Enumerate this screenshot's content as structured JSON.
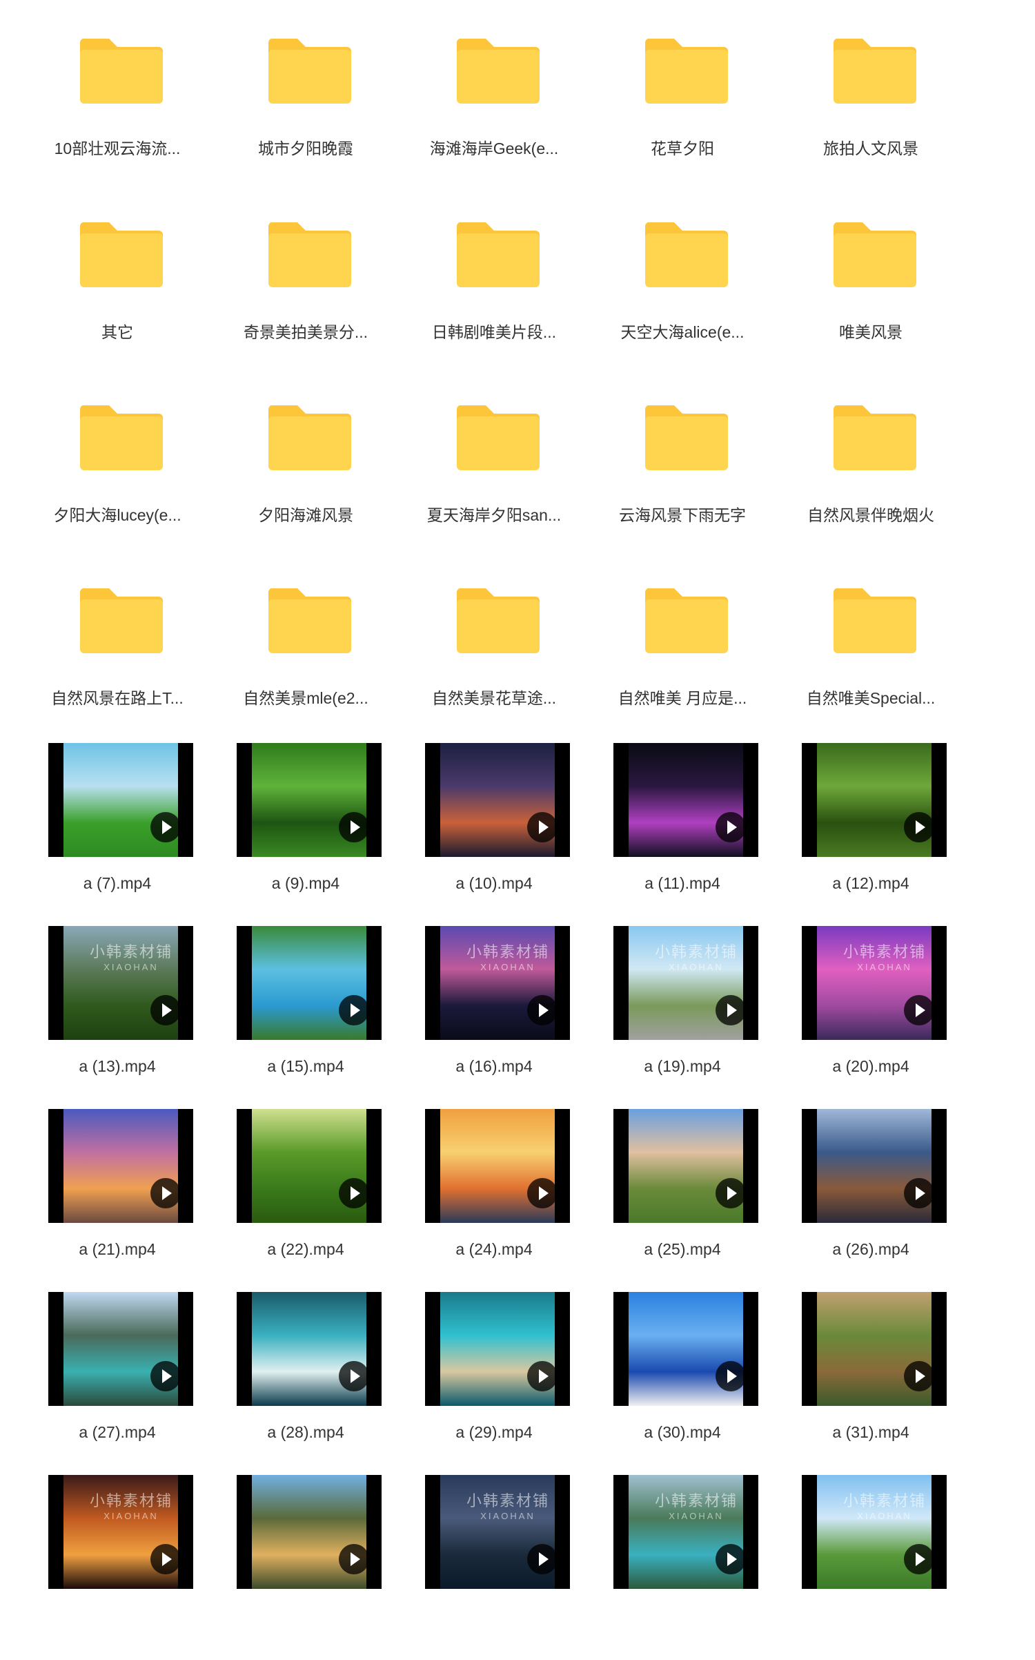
{
  "colors": {
    "folder_front": "#FFD54F",
    "folder_back": "#FDC63A",
    "label_text": "#333333"
  },
  "folders": [
    {
      "name": "10部壮观云海流..."
    },
    {
      "name": "城市夕阳晚霞"
    },
    {
      "name": "海滩海岸Geek(e..."
    },
    {
      "name": "花草夕阳"
    },
    {
      "name": "旅拍人文风景"
    },
    {
      "name": "其它"
    },
    {
      "name": "奇景美拍美景分..."
    },
    {
      "name": "日韩剧唯美片段..."
    },
    {
      "name": "天空大海alice(e..."
    },
    {
      "name": "唯美风景"
    },
    {
      "name": "夕阳大海lucey(e..."
    },
    {
      "name": "夕阳海滩风景"
    },
    {
      "name": "夏天海岸夕阳san..."
    },
    {
      "name": "云海风景下雨无字"
    },
    {
      "name": "自然风景伴晚烟火"
    },
    {
      "name": "自然风景在路上T..."
    },
    {
      "name": "自然美景mle(e2..."
    },
    {
      "name": "自然美景花草途..."
    },
    {
      "name": "自然唯美 月应是..."
    },
    {
      "name": "自然唯美Special..."
    }
  ],
  "videos": [
    {
      "name": "a (7).mp4",
      "thumb_colors": [
        "#6fc3e6",
        "#b8e0f0",
        "#3aa02a",
        "#2e8a22"
      ],
      "subject": "grassland"
    },
    {
      "name": "a (9).mp4",
      "thumb_colors": [
        "#2f7a1c",
        "#5fb33a",
        "#1d5512",
        "#3a8a22"
      ],
      "subject": "dandelion"
    },
    {
      "name": "a (10).mp4",
      "thumb_colors": [
        "#1c2040",
        "#4b3a6b",
        "#c9623a",
        "#1a1a2e"
      ],
      "subject": "fireworks"
    },
    {
      "name": "a (11).mp4",
      "thumb_colors": [
        "#0a0a14",
        "#2a1840",
        "#b040c0",
        "#101020"
      ],
      "subject": "ferris-wheel"
    },
    {
      "name": "a (12).mp4",
      "thumb_colors": [
        "#3a6a1c",
        "#6ea83a",
        "#2a5010",
        "#4a7a22"
      ],
      "subject": "butterfly"
    },
    {
      "name": "a (13).mp4",
      "thumb_colors": [
        "#8aa8b8",
        "#5c7a5a",
        "#2f5a1c",
        "#1e4010"
      ],
      "subject": "forest",
      "watermark": true
    },
    {
      "name": "a (15).mp4",
      "thumb_colors": [
        "#3a8a3a",
        "#5cc0e0",
        "#2a9ad0",
        "#3a7a2a"
      ],
      "subject": "river"
    },
    {
      "name": "a (16).mp4",
      "thumb_colors": [
        "#5a4ab0",
        "#c05a9a",
        "#1a1a3a",
        "#0a0a1a"
      ],
      "subject": "city",
      "watermark": true
    },
    {
      "name": "a (19).mp4",
      "thumb_colors": [
        "#8ac8f0",
        "#d0e8f4",
        "#7a9a5a",
        "#a0a0a0"
      ],
      "subject": "road",
      "watermark": true
    },
    {
      "name": "a (20).mp4",
      "thumb_colors": [
        "#7a3ac0",
        "#e060c0",
        "#a04aa0",
        "#3a2a5a"
      ],
      "subject": "marina",
      "watermark": true
    },
    {
      "name": "a (21).mp4",
      "thumb_colors": [
        "#4a5ac0",
        "#c070a0",
        "#f0a050",
        "#6a4a40"
      ],
      "subject": "sunset-clouds"
    },
    {
      "name": "a (22).mp4",
      "thumb_colors": [
        "#d0e090",
        "#5a9a2a",
        "#3a7a1a",
        "#2a5a10"
      ],
      "subject": "forest-sun"
    },
    {
      "name": "a (24).mp4",
      "thumb_colors": [
        "#f0a040",
        "#f8d070",
        "#e07030",
        "#2a3a5a"
      ],
      "subject": "ocean-sunset"
    },
    {
      "name": "a (25).mp4",
      "thumb_colors": [
        "#6aa0e0",
        "#e0c0a0",
        "#6a8a3a",
        "#4a7a2a"
      ],
      "subject": "meadow"
    },
    {
      "name": "a (26).mp4",
      "thumb_colors": [
        "#a0b8d8",
        "#3a5a8a",
        "#8a5a3a",
        "#2a2a3a"
      ],
      "subject": "ship-deck"
    },
    {
      "name": "a (27).mp4",
      "thumb_colors": [
        "#c0d8f0",
        "#4a6a5a",
        "#3ab0b0",
        "#2a4a3a"
      ],
      "subject": "lake"
    },
    {
      "name": "a (28).mp4",
      "thumb_colors": [
        "#1a5a6a",
        "#3ab0c0",
        "#e0f0f0",
        "#0a3a4a"
      ],
      "subject": "whirlpool"
    },
    {
      "name": "a (29).mp4",
      "thumb_colors": [
        "#1a7a8a",
        "#30c0d0",
        "#d8c8a0",
        "#0a5a6a"
      ],
      "subject": "coast"
    },
    {
      "name": "a (30).mp4",
      "thumb_colors": [
        "#2a80e0",
        "#6ab0f0",
        "#1a4ab0",
        "#f0f0f0"
      ],
      "subject": "santorini"
    },
    {
      "name": "a (31).mp4",
      "thumb_colors": [
        "#c0a070",
        "#6a8a3a",
        "#8a6a3a",
        "#3a5a2a"
      ],
      "subject": "cliffs"
    },
    {
      "name": "",
      "thumb_colors": [
        "#3a1a1a",
        "#c05a20",
        "#f0a040",
        "#1a0a0a"
      ],
      "subject": "fireplace",
      "watermark": true
    },
    {
      "name": "",
      "thumb_colors": [
        "#70b0e0",
        "#5a6a3a",
        "#e0b060",
        "#3a4a2a"
      ],
      "subject": "canyon-lake"
    },
    {
      "name": "",
      "thumb_colors": [
        "#2a3a5a",
        "#4a5a7a",
        "#1a2a3a",
        "#0a1a2a"
      ],
      "subject": "night-sky",
      "watermark": true
    },
    {
      "name": "",
      "thumb_colors": [
        "#a0c0d0",
        "#4a7a5a",
        "#3ab0c0",
        "#2a5a3a"
      ],
      "subject": "alpine-lake",
      "watermark": true
    },
    {
      "name": "",
      "thumb_colors": [
        "#80c0f0",
        "#d0e8f8",
        "#5a9a3a",
        "#3a7a2a"
      ],
      "subject": "valley",
      "watermark": true
    }
  ],
  "watermark": {
    "line1": "小韩素材铺",
    "line2": "XIAOHAN"
  }
}
